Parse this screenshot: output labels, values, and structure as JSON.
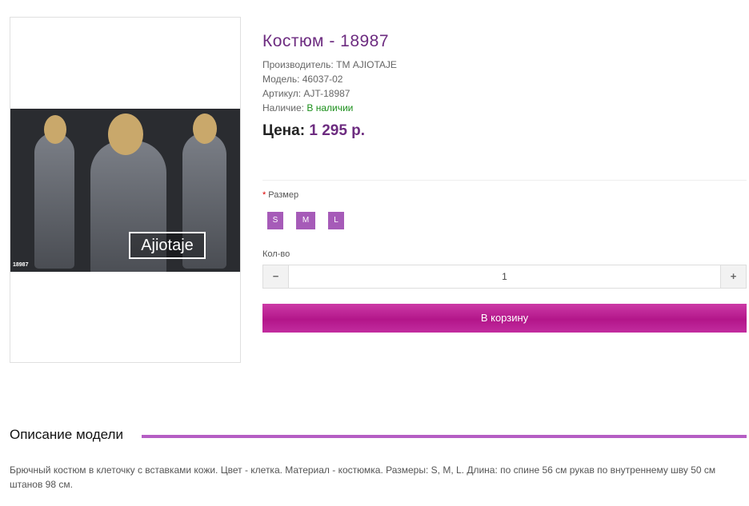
{
  "product": {
    "title": "Костюм - 18987",
    "manufacturer_label": "Производитель:",
    "manufacturer": "ТМ AJIOTAJE",
    "model_label": "Модель:",
    "model": "46037-02",
    "sku_label": "Артикул:",
    "sku": "AJT-18987",
    "availability_label": "Наличие:",
    "availability": "В наличии",
    "price_label": "Цена:",
    "price": "1 295 р.",
    "image_logo": "Ajiotaje",
    "image_code": "18987"
  },
  "options": {
    "required_mark": "*",
    "size_label": "Размер",
    "sizes": [
      "S",
      "M",
      "L"
    ],
    "qty_label": "Кол-во",
    "qty_value": "1",
    "minus": "−",
    "plus": "+",
    "cart_button": "В корзину"
  },
  "description": {
    "heading": "Описание модели",
    "text": "Брючный костюм в клеточку с вставками кожи. Цвет - клетка. Материал - костюмка. Размеры: S, M, L. Длина: по спине 56 см рукав по внутреннему шву 50 см штанов 98 см."
  },
  "colors": {
    "accent": "#6d2c80",
    "button": "#b3168a",
    "size_button": "#a65bb8",
    "in_stock": "#1a8f1a"
  }
}
